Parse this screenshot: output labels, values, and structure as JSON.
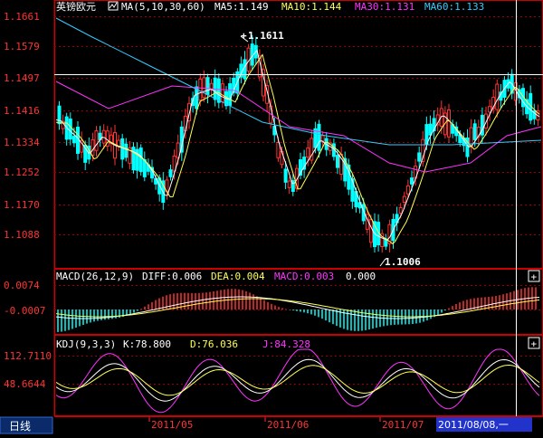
{
  "header": {
    "symbol": "英镑欧元",
    "ma_label": "MA(5,10,30,60)",
    "ma5": "MA5:1.149",
    "ma10": "MA10:1.144",
    "ma30": "MA30:1.131",
    "ma60": "MA60:1.133"
  },
  "price_panel": {
    "ticks": [
      "1.1661",
      "1.1579",
      "1.1497",
      "1.1416",
      "1.1334",
      "1.1252",
      "1.1170",
      "1.1088"
    ],
    "high_marker": "1.1611",
    "low_marker": "1.1006"
  },
  "macd_panel": {
    "title": "MACD(26,12,9)",
    "diff": "DIFF:0.006",
    "dea": "DEA:0.004",
    "macd": "MACD:0.003",
    "extra": "0.000",
    "ticks": [
      "0.0074",
      "-0.0007"
    ],
    "button": "+"
  },
  "kdj_panel": {
    "title": "KDJ(9,3,3)",
    "k": "K:78.800",
    "d": "D:76.036",
    "j": "J:84.328",
    "ticks": [
      "112.7110",
      "48.6644"
    ],
    "button": "+"
  },
  "footer": {
    "period_tab": "日线",
    "dates": [
      "2011/05",
      "2011/06",
      "2011/07"
    ],
    "cursor_date": "2011/08/08,一"
  },
  "colors": {
    "up": "#ff3333",
    "down": "#00ffff",
    "ma5": "#ffffff",
    "ma10": "#ffff55",
    "ma30": "#ff33ff",
    "ma60": "#33ccff",
    "grid": "#990000",
    "axis_text": "#ff3333"
  }
}
